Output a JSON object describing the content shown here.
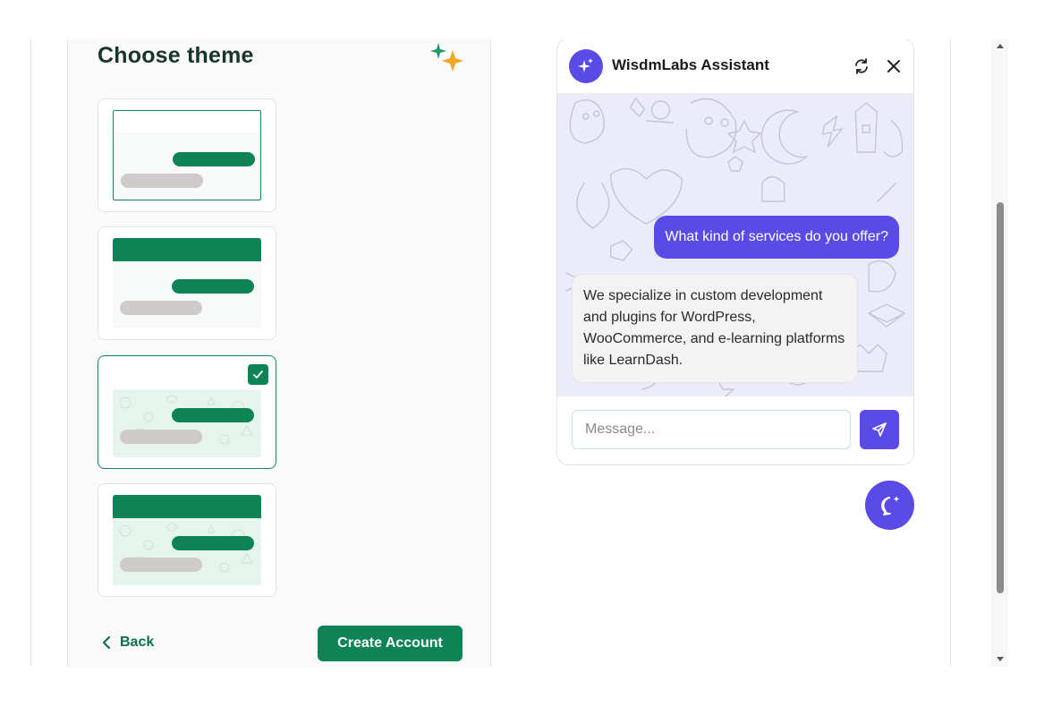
{
  "theme_panel": {
    "title": "Choose theme",
    "themes": [
      {
        "id": "theme-1",
        "selected": false
      },
      {
        "id": "theme-2",
        "selected": false
      },
      {
        "id": "theme-3",
        "selected": true
      },
      {
        "id": "theme-4",
        "selected": false
      }
    ],
    "back_label": "Back",
    "create_label": "Create Account"
  },
  "chat": {
    "bot_name": "WisdmLabs Assistant",
    "user_message": "What kind of services do you offer?",
    "bot_message": "We specialize in custom development and plugins for WordPress, WooCommerce, and e-learning platforms like LearnDash.",
    "input_placeholder": "Message..."
  },
  "colors": {
    "accent_green": "#0e8456",
    "accent_purple": "#5b4be6",
    "chat_background": "#ecebfa"
  },
  "icons": [
    "sparkle-icon",
    "checkmark-icon",
    "chevron-left-icon",
    "bot-sparkle-icon",
    "refresh-icon",
    "close-icon",
    "send-icon",
    "chat-launcher-icon"
  ]
}
